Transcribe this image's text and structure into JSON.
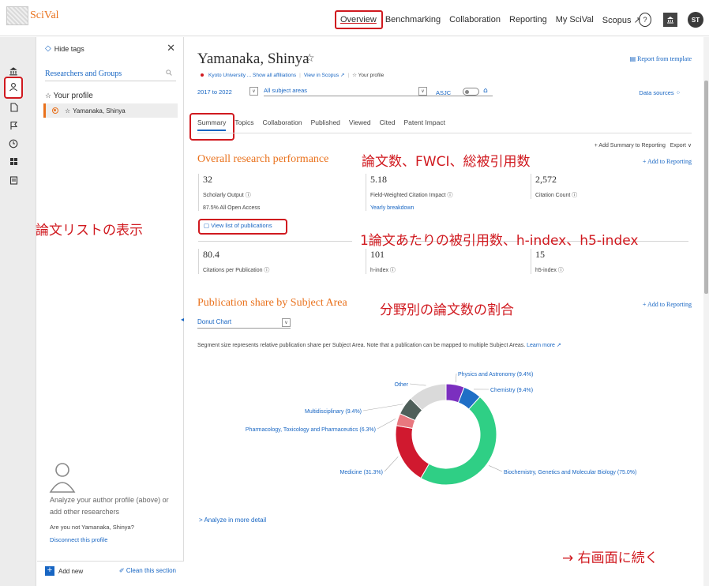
{
  "topbar": {
    "logo_text": "SciVal",
    "nav": [
      "Overview",
      "Benchmarking",
      "Collaboration",
      "Reporting",
      "My SciVal",
      "Scopus ↗"
    ],
    "active_nav": "Overview",
    "help_icon_glyph": "?",
    "avatar_initials": "ST"
  },
  "panel": {
    "hide_tags": "Hide tags",
    "section_label": "Researchers and Groups",
    "your_profile": "Your profile",
    "profile_item": "Yamanaka, Shinya",
    "analyze_text": "Analyze your author profile (above) or add other researchers",
    "not_you": "Are you not Yamanaka, Shinya?",
    "disconnect": "Disconnect this profile",
    "add_new": "Add new",
    "clean_section": "Clean this section"
  },
  "header": {
    "name": "Yamanaka, Shinya",
    "report_from_template": "Report from template",
    "affiliation": "Kyoto University ... Show all affiliations",
    "view_in_scopus": "View in Scopus ↗",
    "your_profile": "Your profile",
    "years": "2017 to 2022",
    "subject_areas": "All subject areas",
    "asjc": "ASJC",
    "data_sources": "Data sources"
  },
  "tabs": [
    "Summary",
    "Topics",
    "Collaboration",
    "Published",
    "Viewed",
    "Cited",
    "Patent Impact"
  ],
  "active_tab": "Summary",
  "summary_actions": {
    "add_summary": "Add Summary to Reporting",
    "export": "Export ∨"
  },
  "overall": {
    "title": "Overall research performance",
    "add_to_reporting": "+ Add to Reporting",
    "metrics_row1": [
      {
        "value": "32",
        "label": "Scholarly Output ⓘ",
        "extra": "87.5% All Open Access"
      },
      {
        "value": "5.18",
        "label": "Field-Weighted Citation Impact ⓘ",
        "extra": "Yearly breakdown"
      },
      {
        "value": "2,572",
        "label": "Citation Count ⓘ",
        "extra": ""
      }
    ],
    "view_list": "View list of publications",
    "metrics_row2": [
      {
        "value": "80.4",
        "label": "Citations per Publication ⓘ"
      },
      {
        "value": "101",
        "label": "h-index ⓘ"
      },
      {
        "value": "15",
        "label": "h5-index ⓘ"
      }
    ]
  },
  "subject_share": {
    "title": "Publication share by Subject Area",
    "add_to_reporting": "+ Add to Reporting",
    "chart_type_select": "Donut Chart",
    "note": "Segment size represents relative publication share per Subject Area. Note that a publication can be mapped to multiple Subject Areas.",
    "learn_more": "Learn more ↗",
    "analyze_more": "Analyze in more detail"
  },
  "chart_data": {
    "type": "pie",
    "style": "donut",
    "categories": [
      "Physics and Astronomy (9.4%)",
      "Chemistry (9.4%)",
      "Biochemistry, Genetics and Molecular Biology (75.0%)",
      "Medicine (31.3%)",
      "Pharmacology, Toxicology and Pharmaceutics (6.3%)",
      "Multidisciplinary (9.4%)",
      "Other"
    ],
    "values": [
      9.4,
      9.4,
      75.0,
      31.3,
      6.3,
      9.4,
      20.0
    ],
    "colors": [
      "#7b2fbf",
      "#1f6fc6",
      "#2fcf85",
      "#d0192f",
      "#e8787f",
      "#4f5f5a",
      "#dadada"
    ]
  },
  "annotations": {
    "overall": "論文数、FWCI、総被引用数",
    "per_paper": "1論文あたりの被引用数、h-index、h5-index",
    "list": "論文リストの表示",
    "subject": "分野別の論文数の割合",
    "continue": "→  右画面に続く"
  },
  "colors": {
    "accent_orange": "#e9711c",
    "link_blue": "#1866c3",
    "annotation_red": "#d0191f"
  },
  "icons": {
    "rail": [
      "institution-icon",
      "user-icon",
      "document-icon",
      "flag-icon",
      "clock-icon",
      "grid-icon",
      "calendar-icon"
    ]
  }
}
